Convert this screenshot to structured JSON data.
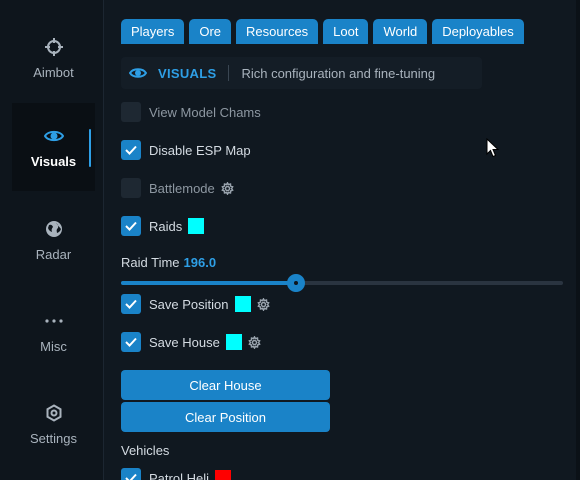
{
  "sidebar": {
    "items": [
      {
        "label": "Aimbot",
        "icon": "crosshair-icon"
      },
      {
        "label": "Visuals",
        "icon": "eye-icon"
      },
      {
        "label": "Radar",
        "icon": "globe-icon"
      },
      {
        "label": "Misc",
        "icon": "more-icon"
      },
      {
        "label": "Settings",
        "icon": "gear-icon"
      }
    ],
    "active": "Visuals"
  },
  "tabs": [
    "Players",
    "Ore",
    "Resources",
    "Loot",
    "World",
    "Deployables"
  ],
  "section": {
    "title": "VISUALS",
    "description": "Rich configuration and fine-tuning"
  },
  "options": [
    {
      "label": "View Model Chams",
      "checked": false
    },
    {
      "label": "Disable ESP Map",
      "checked": true
    },
    {
      "label": "Battlemode",
      "checked": false,
      "gear": true
    },
    {
      "label": "Raids",
      "checked": true,
      "color": "#00ffff"
    },
    {
      "label": "Save Position",
      "checked": true,
      "color": "#00ffff",
      "gear": true
    },
    {
      "label": "Save House",
      "checked": true,
      "color": "#00ffff",
      "gear": true
    }
  ],
  "raid_time": {
    "label": "Raid Time",
    "value": "196.0",
    "fraction": 0.396
  },
  "buttons": {
    "clear_house": "Clear House",
    "clear_position": "Clear Position"
  },
  "vehicles": {
    "label": "Vehicles",
    "items": [
      {
        "label": "Patrol Heli",
        "checked": true,
        "color": "#ff0000"
      }
    ]
  },
  "colors": {
    "accent": "#1a83c8",
    "background": "#101820"
  }
}
